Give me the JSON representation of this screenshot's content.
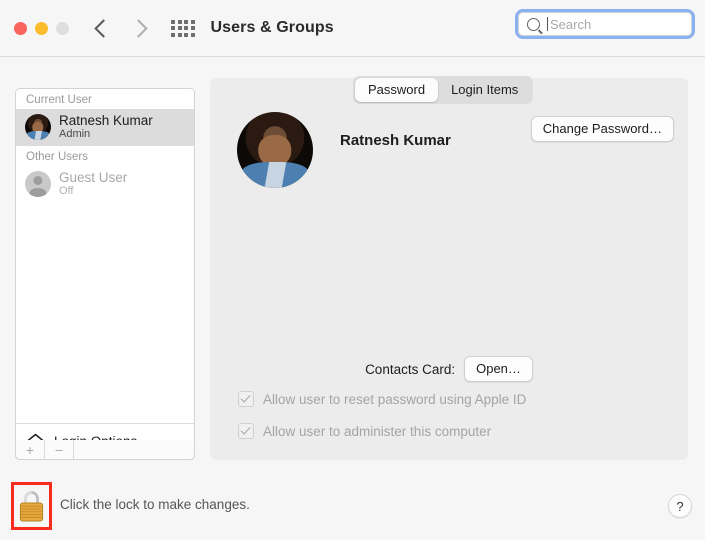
{
  "window": {
    "title": "Users & Groups",
    "traffic_lights": [
      "close-red",
      "minimize-yellow",
      "zoom-gray-disabled"
    ],
    "back_label": "Back",
    "forward_label": "Forward",
    "grid_label": "Show All"
  },
  "search": {
    "placeholder": "Search",
    "value": "",
    "focused": true,
    "accent": "#8ab0ef"
  },
  "sidebar": {
    "groups": [
      {
        "header": "Current User",
        "users": [
          {
            "name": "Ratnesh Kumar",
            "role": "Admin",
            "selected": true,
            "avatar": "user-photo"
          }
        ]
      },
      {
        "header": "Other Users",
        "users": [
          {
            "name": "Guest User",
            "role": "Off",
            "selected": false,
            "avatar": "guest-placeholder"
          }
        ]
      }
    ],
    "login_options_label": "Login Options",
    "add_label": "+",
    "remove_label": "−"
  },
  "main": {
    "tabs": [
      {
        "label": "Password",
        "active": true
      },
      {
        "label": "Login Items",
        "active": false
      }
    ],
    "user_full_name": "Ratnesh Kumar",
    "change_password_label": "Change Password…",
    "contacts_card_label": "Contacts Card:",
    "contacts_open_label": "Open…",
    "checkboxes": [
      {
        "label": "Allow user to reset password using Apple ID",
        "checked": true,
        "disabled": true
      },
      {
        "label": "Allow user to administer this computer",
        "checked": true,
        "disabled": true
      }
    ]
  },
  "footer": {
    "lock_text": "Click the lock to make changes.",
    "lock_state": "locked",
    "help_label": "?",
    "highlight_color": "#f82b1f"
  }
}
